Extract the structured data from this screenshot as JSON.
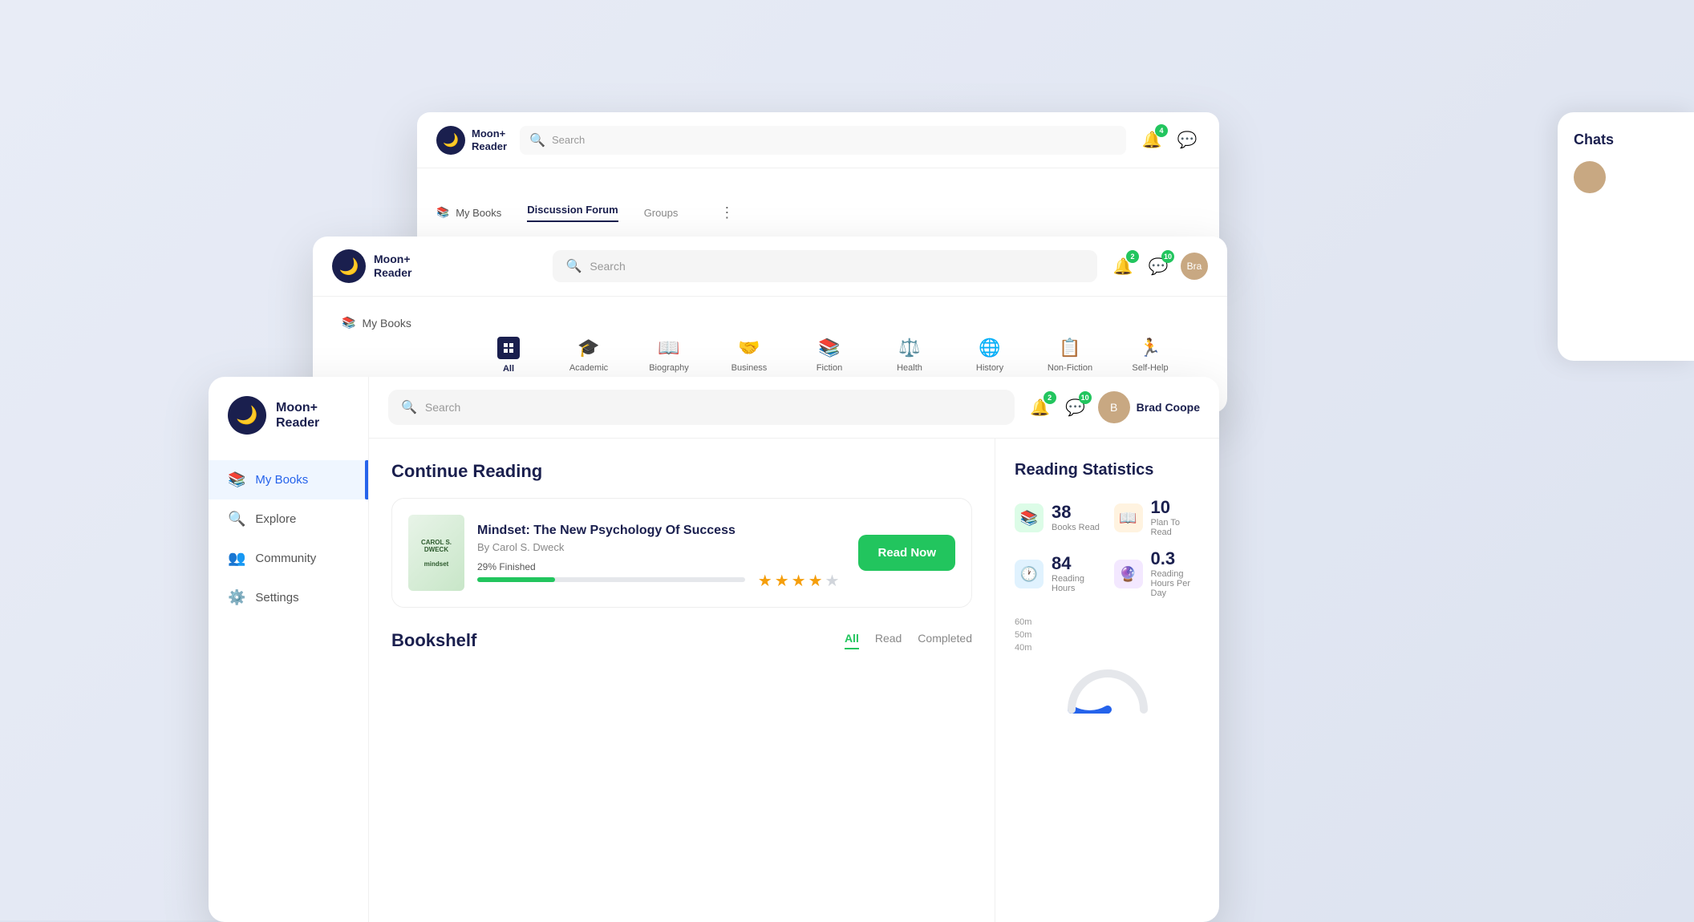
{
  "app": {
    "name": "Moon+",
    "name2": "Reader",
    "logo_char": "🌙"
  },
  "back_window1": {
    "search_placeholder": "Search",
    "sidebar_item": "My Books",
    "tabs": {
      "active": "Discussion Forum",
      "inactive": "Groups"
    },
    "notification_badge": "4",
    "chat_badge": ""
  },
  "back_window2": {
    "search_placeholder": "Search",
    "sidebar_item": "My Books",
    "notification_badge": "2",
    "chat_badge": "10",
    "username_short": "Bra",
    "categories": [
      {
        "label": "All",
        "icon": "all"
      },
      {
        "label": "Academic",
        "icon": "🎓"
      },
      {
        "label": "Biography",
        "icon": "📖"
      },
      {
        "label": "Business",
        "icon": "🤝"
      },
      {
        "label": "Fiction",
        "icon": "📚"
      },
      {
        "label": "Health",
        "icon": "⚖️"
      },
      {
        "label": "History",
        "icon": "🌐"
      },
      {
        "label": "Non-Fiction",
        "icon": "📋"
      },
      {
        "label": "Self-Help",
        "icon": "🏃"
      }
    ]
  },
  "front_window": {
    "search_placeholder": "Search",
    "notification_badge": "2",
    "chat_badge": "10",
    "username": "Brad Coope",
    "nav": [
      {
        "label": "My Books",
        "icon": "📚",
        "active": true
      },
      {
        "label": "Explore",
        "icon": "🔍",
        "active": false
      },
      {
        "label": "Community",
        "icon": "👥",
        "active": false
      },
      {
        "label": "Settings",
        "icon": "⚙️",
        "active": false
      }
    ],
    "continue_reading": {
      "section_title": "Continue Reading",
      "book_title": "Mindset: The New Psychology Of Success",
      "book_author": "By Carol S. Dweck",
      "progress_label": "29% Finished",
      "progress_percent": 29,
      "rating": 4.5,
      "read_now_label": "Read Now"
    },
    "bookshelf": {
      "title": "Bookshelf",
      "tabs": [
        "All",
        "Read",
        "Completed"
      ]
    },
    "reading_stats": {
      "title": "Reading Statistics",
      "stats": [
        {
          "num": "38",
          "label": "Books Read",
          "icon": "📚",
          "color": "green"
        },
        {
          "num": "10",
          "label": "Plan To Read",
          "icon": "📖",
          "color": "orange"
        },
        {
          "num": "84",
          "label": "Reading Hours",
          "icon": "🕐",
          "color": "blue"
        },
        {
          "num": "0.3",
          "label": "Reading Hours Per Day",
          "icon": "🔮",
          "color": "purple"
        }
      ],
      "chart_labels": [
        "60m",
        "50m",
        "40m"
      ]
    }
  },
  "chats_panel": {
    "title": "Chats"
  }
}
